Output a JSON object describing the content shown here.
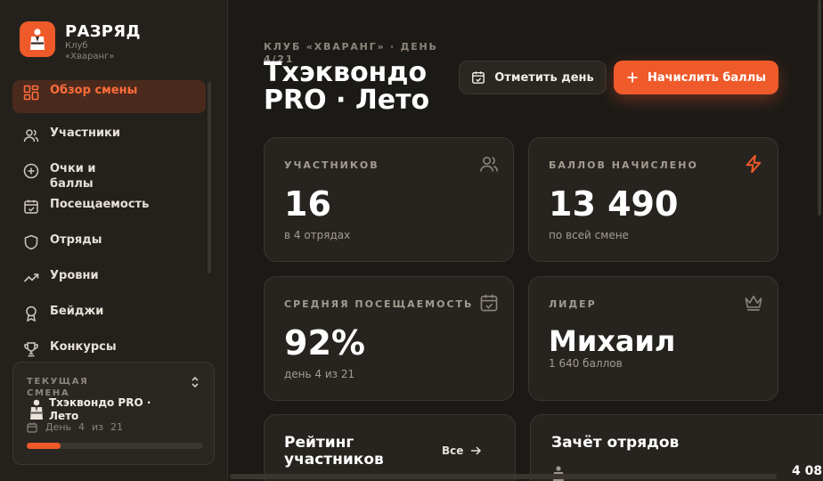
{
  "brand": {
    "name": "РАЗРЯД",
    "club": "Клуб «Хваранг»"
  },
  "sidebar": {
    "items": [
      {
        "label": "Обзор смены",
        "icon": "dashboard-icon",
        "active": true
      },
      {
        "label": "Участники",
        "icon": "users-icon"
      },
      {
        "label": "Очки и баллы",
        "icon": "plus-circle-icon"
      },
      {
        "label": "Посещаемость",
        "icon": "calendar-check-icon"
      },
      {
        "label": "Отряды",
        "icon": "shield-icon"
      },
      {
        "label": "Уровни",
        "icon": "trending-up-icon"
      },
      {
        "label": "Бейджи",
        "icon": "badge-icon"
      },
      {
        "label": "Конкурсы",
        "icon": "trophy-icon"
      }
    ],
    "current_shift": {
      "label": "ТЕКУЩАЯ СМЕНА",
      "name": "Тхэквондо PRO · Лето",
      "day_word": "День",
      "day": "4",
      "of_word": "из",
      "total": "21",
      "progress": 0.19
    }
  },
  "header": {
    "eyebrow": "КЛУБ «ХВАРАНГ» · ДЕНЬ 4/21",
    "title": "Тхэквондо PRO · Лето",
    "mark_day_label": "Отметить день",
    "award_points_label": "Начислить баллы"
  },
  "stats": [
    {
      "label": "УЧАСТНИКОВ",
      "value": "16",
      "sub": "в 4 отрядах",
      "icon": "users-icon"
    },
    {
      "label": "БАЛЛОВ НАЧИСЛЕНО",
      "value": "13 490",
      "sub": "по всей смене",
      "icon": "lightning-icon"
    },
    {
      "label": "СРЕДНЯЯ ПОСЕЩАЕМОСТЬ",
      "value": "92%",
      "sub": "день 4 из 21",
      "icon": "calendar-check-icon"
    },
    {
      "label": "ЛИДЕР",
      "value": "Михаил",
      "sub": "1 640 баллов",
      "icon": "crown-icon"
    }
  ],
  "sections": {
    "rating_title": "Рейтинг участников",
    "all_label": "Все",
    "teams_title": "Зачёт отрядов",
    "team_score_partial": "4 08"
  },
  "colors": {
    "accent": "#ef5a2a",
    "background": "#1c1a17",
    "card": "#272420"
  }
}
